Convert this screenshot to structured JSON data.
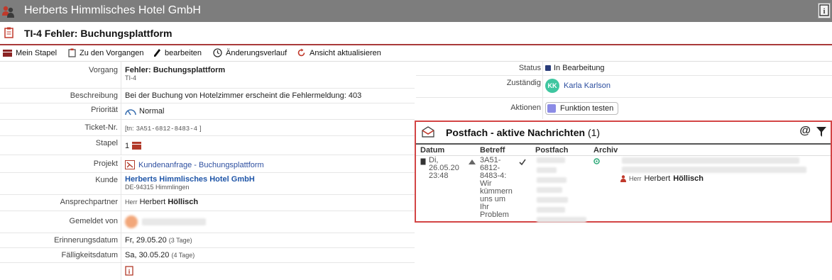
{
  "app": {
    "hotel_name": "Herberts Himmlisches Hotel GmbH"
  },
  "ticket": {
    "title": "TI-4 Fehler: Buchungsplattform"
  },
  "toolbar": {
    "items": [
      {
        "label": "Mein Stapel",
        "icon": "stack-icon"
      },
      {
        "label": "Zu den Vorgangen",
        "icon": "clipboard-icon"
      },
      {
        "label": "bearbeiten",
        "icon": "pencil-icon"
      },
      {
        "label": "Änderungsverlauf",
        "icon": "clock-icon"
      },
      {
        "label": "Ansicht aktualisieren",
        "icon": "refresh-icon"
      }
    ]
  },
  "details": {
    "vorgang": {
      "label": "Vorgang",
      "value": "Fehler: Buchungsplattform",
      "sub": "TI-4"
    },
    "beschreibung": {
      "label": "Beschreibung",
      "value": "Bei der Buchung von Hotelzimmer erscheint die Fehlermeldung: 403"
    },
    "prioritaet": {
      "label": "Priorität",
      "value": "Normal"
    },
    "ticket_nr": {
      "label": "Ticket-Nr.",
      "prefix": "[tn:",
      "value": "3A51-6812-8483-4",
      "suffix": "]"
    },
    "stapel": {
      "label": "Stapel",
      "value": "1"
    },
    "projekt": {
      "label": "Projekt",
      "value": "Kundenanfrage - Buchungsplattform"
    },
    "kunde": {
      "label": "Kunde",
      "value": "Herberts Himmlisches Hotel GmbH",
      "sub": "DE-94315 Himmlingen"
    },
    "ansprechpartner": {
      "label": "Ansprechpartner",
      "salutation": "Herr",
      "first": "Herbert",
      "last": "Höllisch"
    },
    "gemeldet_von": {
      "label": "Gemeldet von"
    },
    "erinnerung": {
      "label": "Erinnerungsdatum",
      "value": "Fr, 29.05.20",
      "note": "(3 Tage)"
    },
    "faelligkeit": {
      "label": "Fälligkeitsdatum",
      "value": "Sa, 30.05.20",
      "note": "(4 Tage)"
    }
  },
  "side": {
    "status": {
      "label": "Status",
      "value": "In Bearbeitung",
      "color": "#2a3d7a"
    },
    "zustaendig": {
      "label": "Zuständig",
      "initials": "KK",
      "value": "Karla Karlson"
    },
    "aktionen": {
      "label": "Aktionen",
      "button": "Funktion testen"
    }
  },
  "mailbox": {
    "title": "Postfach - aktive Nachrichten",
    "count": "(1)",
    "columns": {
      "datum": "Datum",
      "betreff": "Betreff",
      "postfach": "Postfach",
      "archiv": "Archiv"
    },
    "message": {
      "datum": "Di,\n26.05.20\n23:48",
      "betreff": "3A51-\n6812-\n8483-4:\nWir\nkümmern\nuns um\nIhr\nProblem",
      "contact_salutation": "Herr",
      "contact_first": "Herbert",
      "contact_last": "Höllisch"
    }
  }
}
